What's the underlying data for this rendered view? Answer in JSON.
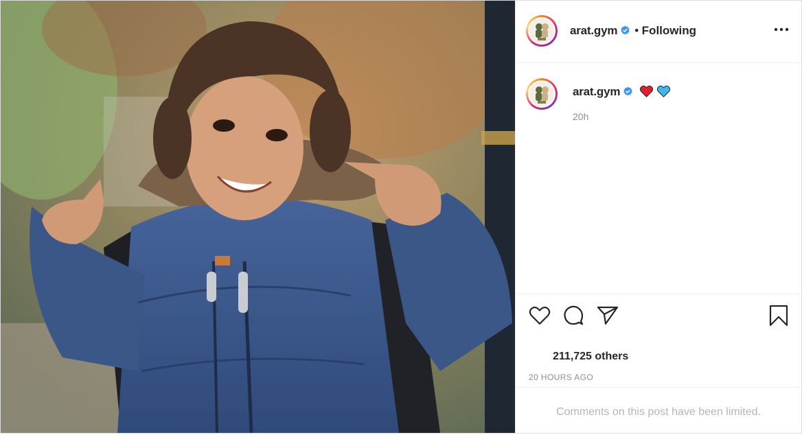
{
  "post": {
    "username": "arat.gym",
    "separator": "•",
    "follow_status": "Following",
    "caption_time": "20h",
    "likes_text": "211,725 others",
    "timestamp": "20 HOURS AGO",
    "comments_notice": "Comments on this post have been limited."
  },
  "icons": {
    "verified": "verified-badge-icon",
    "more": "more-options-icon",
    "like": "heart-icon",
    "comment": "comment-bubble-icon",
    "share": "paper-plane-icon",
    "save": "bookmark-icon",
    "caption_emojis": [
      "red-heart-emoji",
      "blue-heart-emoji"
    ]
  },
  "colors": {
    "verified_blue": "#3897f0",
    "text": "#262626",
    "muted": "#8e8e8e",
    "red_heart": "#e0202c",
    "blue_heart": "#3fb6ee",
    "jacket_blue": "#3f5c8e"
  }
}
